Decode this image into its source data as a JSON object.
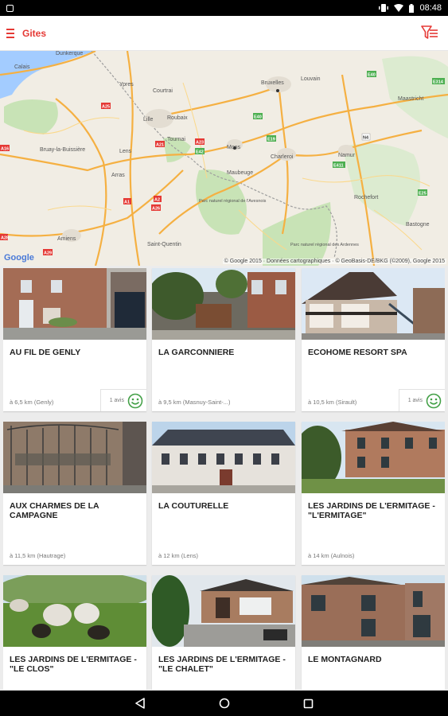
{
  "status_bar": {
    "time": "08:48"
  },
  "app_bar": {
    "title": "Gites"
  },
  "map": {
    "attribution": "© Google 2015 · Données cartographiques · © GeoBasis-DE/BKG (©2009), Google 2015",
    "logo": "Google",
    "places": [
      "Dunkerque",
      "Calais",
      "Ypres",
      "Courtrai",
      "Bruxelles",
      "Louvain",
      "Lille",
      "Roubaix",
      "Tournai",
      "Mons",
      "Charleroi",
      "Namur",
      "Lens",
      "Arras",
      "Maubeuge",
      "Bruay-la-Buissière",
      "Amiens",
      "Saint-Quentin",
      "Rochefort",
      "Bastogne",
      "Maastricht",
      "Parc naturel régional de l'Avesnois",
      "Parc naturel régional des Ardennes"
    ],
    "road_labels": [
      "A16",
      "A25",
      "E40",
      "A21",
      "A23",
      "A1",
      "A2",
      "A26",
      "A29",
      "A28",
      "E19",
      "E42",
      "E411",
      "E314",
      "E25",
      "E40",
      "N4"
    ]
  },
  "cards": [
    {
      "title": "AU FIL DE GENLY",
      "distance": "à 6,5 km (Genly)",
      "reviews": "1 avis"
    },
    {
      "title": "LA GARCONNIERE",
      "distance": "à 9,5 km (Masnuy-Saint-...)",
      "reviews": ""
    },
    {
      "title": "ECOHOME RESORT SPA",
      "distance": "à 10,5 km (Sirault)",
      "reviews": "1 avis"
    },
    {
      "title": "AUX CHARMES DE LA CAMPAGNE",
      "distance": "à 11,5 km (Hautrage)",
      "reviews": ""
    },
    {
      "title": "LA COUTURELLE",
      "distance": "à 12 km (Lens)",
      "reviews": ""
    },
    {
      "title": "LES JARDINS DE L'ERMITAGE - \"L'ERMITAGE\"",
      "distance": "à 14 km (Aulnois)",
      "reviews": ""
    },
    {
      "title": "LES JARDINS DE L'ERMITAGE - \"LE CLOS\"",
      "distance": "",
      "reviews": ""
    },
    {
      "title": "LES JARDINS DE L'ERMITAGE - \"LE CHALET\"",
      "distance": "",
      "reviews": ""
    },
    {
      "title": "LE MONTAGNARD",
      "distance": "",
      "reviews": ""
    }
  ],
  "colors": {
    "accent": "#e53935",
    "smiley": "#43a047"
  },
  "icons": {
    "menu": "hamburger-icon",
    "filter": "filter-icon",
    "review": "smiley-icon",
    "back": "back-icon",
    "home": "home-icon",
    "recents": "recents-icon"
  }
}
